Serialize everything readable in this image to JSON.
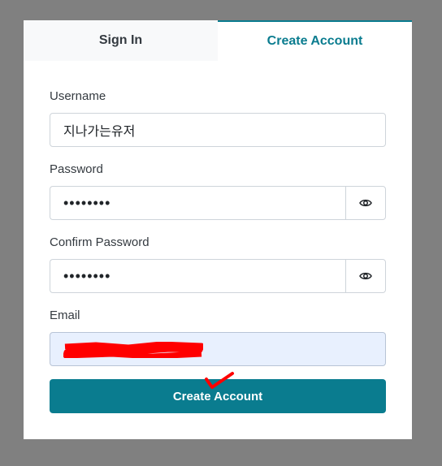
{
  "tabs": {
    "sign_in": "Sign In",
    "create_account": "Create Account"
  },
  "form": {
    "username_label": "Username",
    "username_value": "지나가는유저",
    "password_label": "Password",
    "password_value": "••••••••",
    "confirm_label": "Confirm Password",
    "confirm_value": "••••••••",
    "email_label": "Email",
    "submit_label": "Create Account"
  },
  "colors": {
    "accent": "#0a7c8f",
    "redaction": "#ff0000",
    "email_autofill_bg": "#e8f0fe"
  },
  "icons": {
    "password_toggle": "eye-icon",
    "confirm_toggle": "eye-icon"
  }
}
